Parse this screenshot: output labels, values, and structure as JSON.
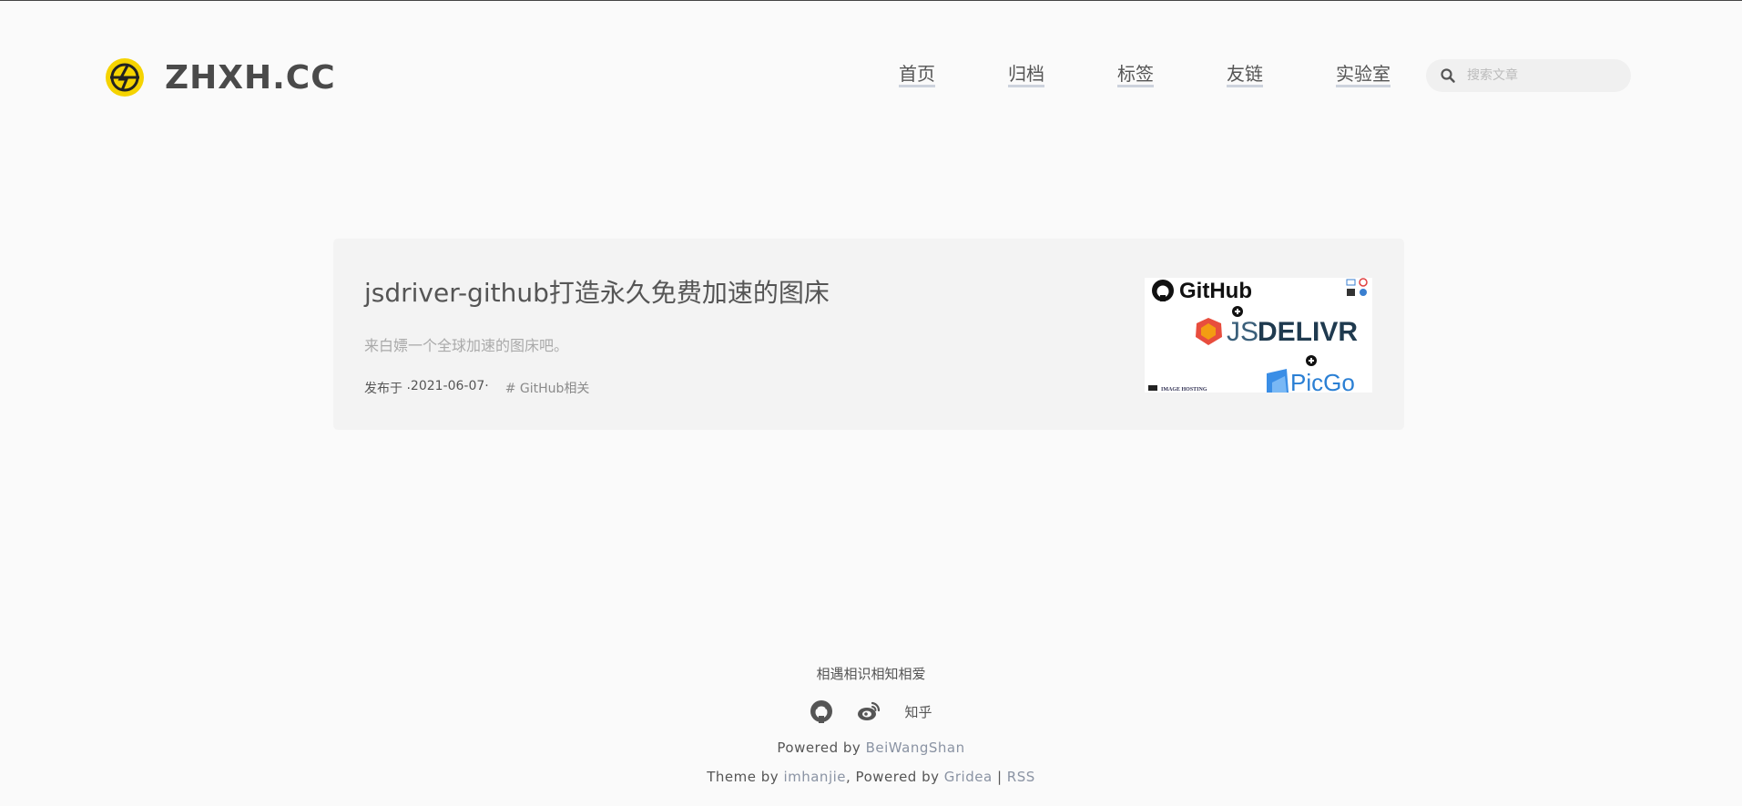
{
  "header": {
    "site_title": "ZHXH.CC",
    "nav": [
      {
        "label": "首页"
      },
      {
        "label": "归档"
      },
      {
        "label": "标签"
      },
      {
        "label": "友链"
      },
      {
        "label": "实验室"
      }
    ],
    "search": {
      "placeholder": "搜索文章",
      "icon": "search-icon"
    }
  },
  "post": {
    "title": "jsdriver-github打造永久免费加速的图床",
    "summary": "来白嫖一个全球加速的图床吧。",
    "published_prefix": "发布于 · ",
    "date": "2021-06-07",
    "date_suffix": " ·",
    "tag": "# GitHub相关",
    "thumbnail": {
      "line1": "GitHub",
      "line2_js": "JS",
      "line2_delivr": "DELIVR",
      "line3": "PicGo",
      "caption": "IMAGE HOSTING"
    }
  },
  "footer": {
    "motto": "相遇相识相知相爱",
    "social": {
      "github": "github-icon",
      "weibo": "weibo-icon",
      "zhihu": "知乎"
    },
    "powered_prefix": "Powered by ",
    "powered_link": "BeiWangShan",
    "theme_prefix": "Theme by ",
    "theme_author": "imhanjie",
    "theme_mid": ", Powered by ",
    "theme_gridea": "Gridea",
    "theme_sep": " | ",
    "theme_rss": "RSS"
  },
  "colors": {
    "background": "#fafafa",
    "card": "#f3f3f3",
    "logo_yellow": "#f5d300",
    "link_muted": "#8a93a3"
  }
}
